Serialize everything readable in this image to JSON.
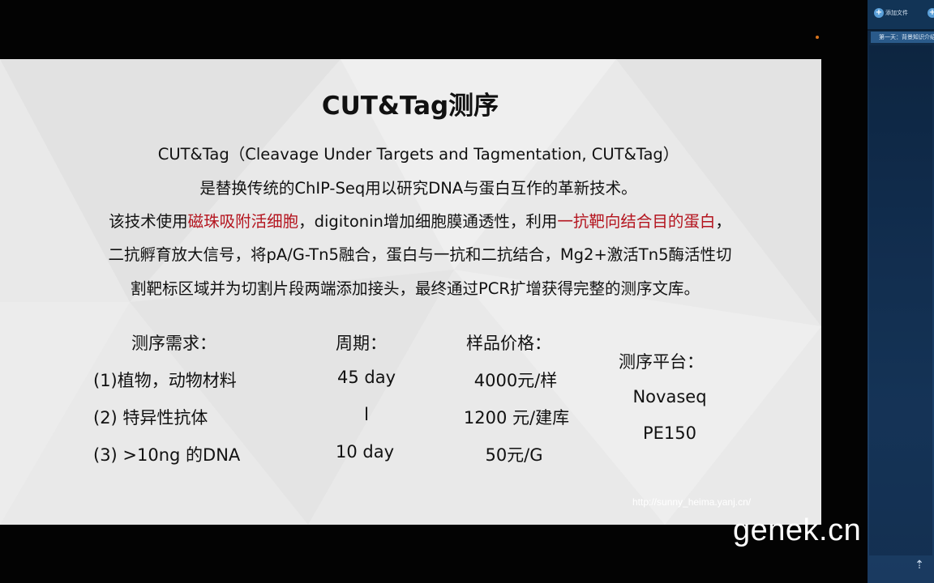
{
  "slide": {
    "title": "CUT&Tag测序",
    "intro_line1": "CUT&Tag（Cleavage Under Targets and Tagmentation, CUT&Tag）",
    "intro_line2": "是替换传统的ChIP-Seq用以研究DNA与蛋白互作的革新技术。",
    "line3_prefix": "该技术使用",
    "line3_red1": "磁珠吸附活细胞",
    "line3_mid": "，digitonin增加细胞膜通透性，利用",
    "line3_red2": "一抗靶向结合目的蛋白",
    "line3_suffix": "，",
    "line4": "二抗孵育放大信号，将pA/G-Tn5融合，蛋白与一抗和二抗结合，Mg2+激活Tn5酶活性切",
    "line5": "割靶标区域并为切割片段两端添加接头，最终通过PCR扩增获得完整的测序文库。",
    "table": {
      "headers": {
        "requirements": "测序需求：",
        "period": "周期：",
        "price": "样品价格：",
        "platform": "测序平台："
      },
      "rows": [
        {
          "requirement": "(1)植物，动物材料",
          "period": "45 day",
          "price": "4000元/样"
        },
        {
          "requirement": "(2) 特异性抗体",
          "period": "l",
          "price": "1200 元/建库"
        },
        {
          "requirement": "(3) >10ng 的DNA",
          "period": "10 day",
          "price": "50元/G"
        }
      ],
      "platform_lines": [
        "Novaseq",
        "PE150"
      ]
    },
    "watermark": "http://sunny_heima.yanj.cn/"
  },
  "brand": "genek.cn",
  "side_panel": {
    "add_file_label": "添加文件",
    "tab_label": "第一天：背景知识介绍"
  },
  "colors": {
    "highlight_red": "#b4141e",
    "slide_bg": "#e9e9e9",
    "side_panel": "#16365a"
  }
}
